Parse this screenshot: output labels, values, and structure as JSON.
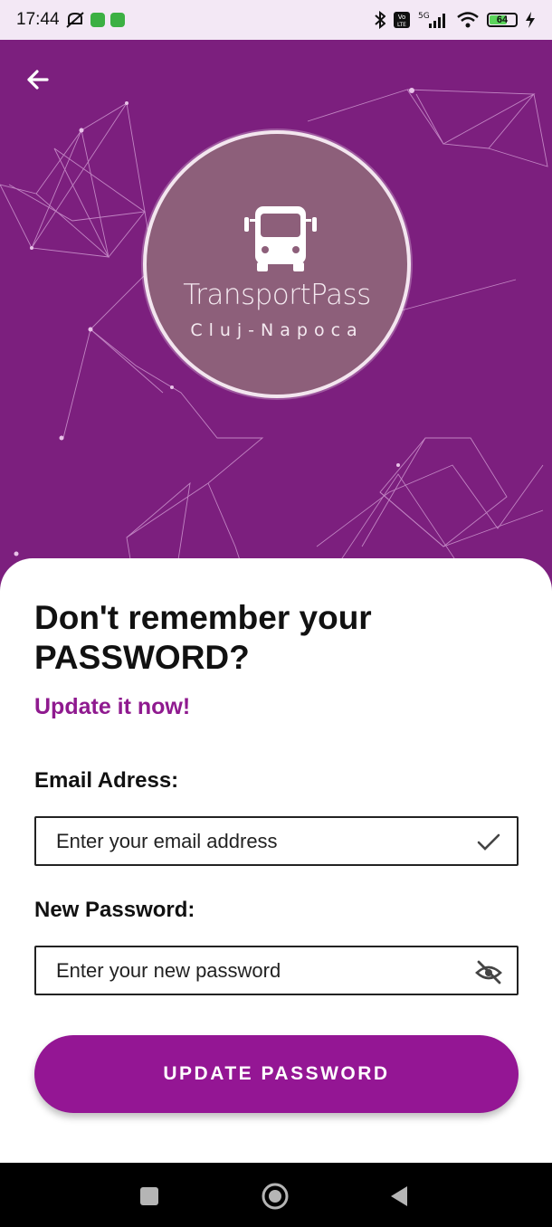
{
  "status_bar": {
    "time": "17:44",
    "battery": "64",
    "icons": [
      "mute-icon",
      "app-icon",
      "app-icon",
      "bluetooth-icon",
      "volte-icon",
      "5g-signal-icon",
      "wifi-icon",
      "battery-icon",
      "charging-icon"
    ]
  },
  "header": {
    "back_icon": "arrow-left-icon"
  },
  "logo": {
    "title": "TransportPass",
    "subtitle": "Cluj-Napoca",
    "icon": "bus-icon"
  },
  "form": {
    "heading": "Don't remember your PASSWORD?",
    "subheading": "Update it now!",
    "email_label": "Email Adress:",
    "email_placeholder": "Enter your email address",
    "email_icon": "check-icon",
    "password_label": "New Password:",
    "password_placeholder": "Enter your new password",
    "password_icon": "eye-off-icon",
    "submit_label": "UPDATE PASSWORD"
  },
  "colors": {
    "brand_purple": "#941694",
    "hero_background": "#7c1f7e",
    "accent_text": "#8f1a8f"
  },
  "nav_bar": {
    "icons": [
      "recents-icon",
      "home-icon",
      "back-triangle-icon"
    ]
  }
}
